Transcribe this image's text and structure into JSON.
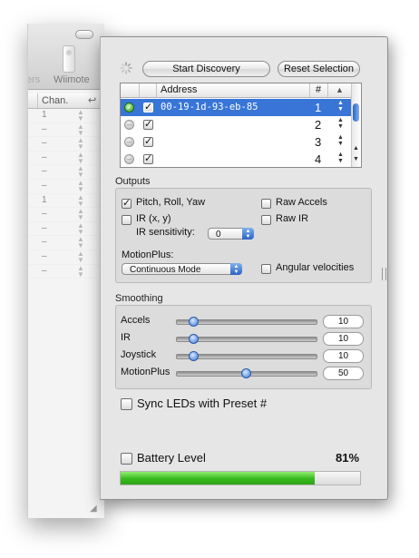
{
  "background_window": {
    "toolbar_labels": [
      "ers",
      "Wiimote"
    ],
    "column_header": "Chan.",
    "rows": [
      "1",
      "–",
      "–",
      "–",
      "–",
      "–",
      "1",
      "–",
      "–",
      "–",
      "–",
      "–"
    ]
  },
  "toolbar": {
    "start_discovery": "Start Discovery",
    "reset_selection": "Reset Selection"
  },
  "device_table": {
    "headers": {
      "address": "Address",
      "number": "#"
    },
    "rows": [
      {
        "connected": true,
        "enabled": true,
        "address": "00-19-1d-93-eb-85",
        "number": "1"
      },
      {
        "connected": false,
        "enabled": true,
        "address": "",
        "number": "2"
      },
      {
        "connected": false,
        "enabled": true,
        "address": "",
        "number": "3"
      },
      {
        "connected": false,
        "enabled": true,
        "address": "",
        "number": "4"
      }
    ]
  },
  "outputs": {
    "title": "Outputs",
    "pitch_roll_yaw": {
      "label": "Pitch, Roll, Yaw",
      "checked": true
    },
    "raw_accels": {
      "label": "Raw Accels",
      "checked": false
    },
    "ir_xy": {
      "label": "IR (x, y)",
      "checked": false
    },
    "raw_ir": {
      "label": "Raw IR",
      "checked": false
    },
    "ir_sensitivity_label": "IR sensitivity:",
    "ir_sensitivity_value": "0",
    "motionplus_label": "MotionPlus:",
    "motionplus_value": "Continuous Mode",
    "angular_velocities": {
      "label": "Angular velocities",
      "checked": false
    }
  },
  "smoothing": {
    "title": "Smoothing",
    "sliders": [
      {
        "label": "Accels",
        "value": "10",
        "position": 0.1
      },
      {
        "label": "IR",
        "value": "10",
        "position": 0.1
      },
      {
        "label": "Joystick",
        "value": "10",
        "position": 0.1
      },
      {
        "label": "MotionPlus",
        "value": "50",
        "position": 0.5
      }
    ]
  },
  "sync_leds": {
    "label": "Sync LEDs with Preset #",
    "checked": false
  },
  "battery": {
    "label": "Battery Level",
    "checked": false,
    "percent_text": "81%",
    "level": 0.81
  },
  "colors": {
    "selection": "#3875d7",
    "battery_green": "#38b81e",
    "slider_blue": "#3b78d6"
  }
}
